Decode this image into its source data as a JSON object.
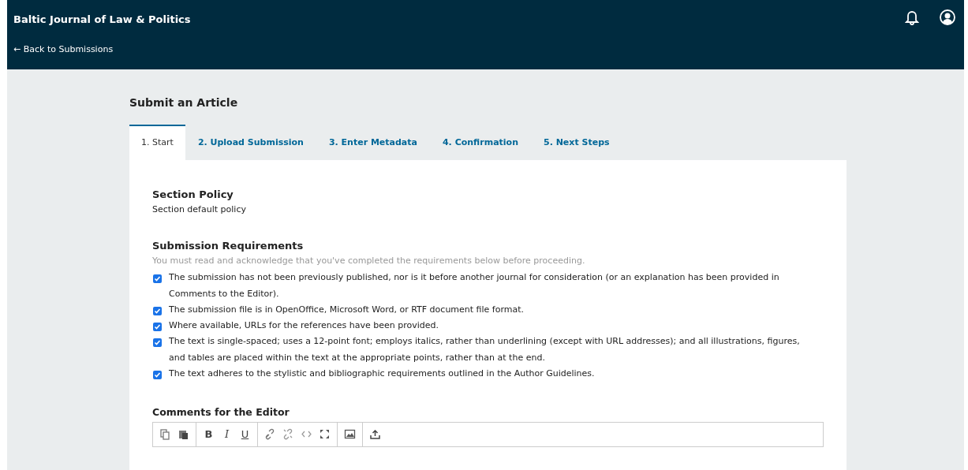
{
  "header": {
    "journal_title": "Baltic Journal of Law & Politics",
    "back_link": "← Back to Submissions"
  },
  "page_title": "Submit an Article",
  "tabs": [
    {
      "label": "1. Start",
      "selected": true
    },
    {
      "label": "2. Upload Submission",
      "selected": false
    },
    {
      "label": "3. Enter Metadata",
      "selected": false
    },
    {
      "label": "4. Confirmation",
      "selected": false
    },
    {
      "label": "5. Next Steps",
      "selected": false
    }
  ],
  "section_policy": {
    "heading": "Section Policy",
    "text": "Section default policy"
  },
  "requirements": {
    "heading": "Submission Requirements",
    "description": "You must read and acknowledge that you've completed the requirements below before proceeding.",
    "items": [
      {
        "text": "The submission has not been previously published, nor is it before another journal for consideration (or an explanation has been provided in Comments to the Editor).",
        "checked": true
      },
      {
        "text": "The submission file is in OpenOffice, Microsoft Word, or RTF document file format.",
        "checked": true
      },
      {
        "text": "Where available, URLs for the references have been provided.",
        "checked": true
      },
      {
        "text": "The text is single-spaced; uses a 12-point font; employs italics, rather than underlining (except with URL addresses); and all illustrations, figures, and tables are placed within the text at the appropriate points, rather than at the end.",
        "checked": true
      },
      {
        "text": "The text adheres to the stylistic and bibliographic requirements outlined in the Author Guidelines.",
        "checked": true
      }
    ]
  },
  "comments": {
    "heading": "Comments for the Editor",
    "toolbar": [
      [
        {
          "kind": "copy"
        },
        {
          "kind": "paste"
        }
      ],
      [
        {
          "kind": "bold",
          "label": "B"
        },
        {
          "kind": "italic",
          "label": "I"
        },
        {
          "kind": "underline",
          "label": "U"
        }
      ],
      [
        {
          "kind": "link"
        },
        {
          "kind": "unlink"
        },
        {
          "kind": "code"
        },
        {
          "kind": "fullscreen"
        }
      ],
      [
        {
          "kind": "image"
        }
      ],
      [
        {
          "kind": "upload"
        }
      ]
    ]
  }
}
